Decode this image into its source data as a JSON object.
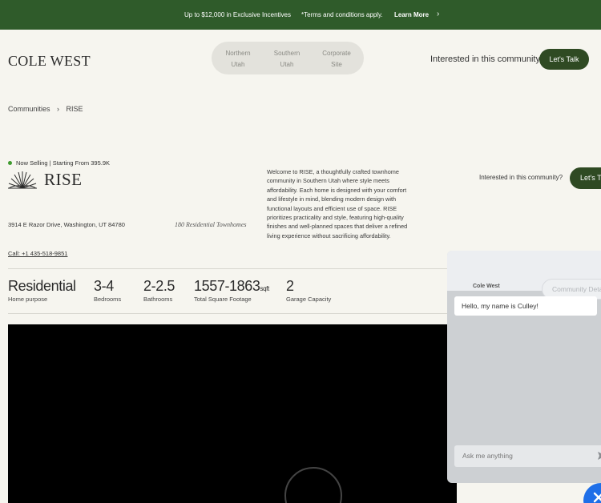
{
  "promo": {
    "incentive": "Up to $12,000 in Exclusive Incentives",
    "terms": "*Terms and conditions apply.",
    "learn_more": "Learn More",
    "chevron": "›"
  },
  "brand": {
    "logo": "COLE WEST"
  },
  "regions": [
    {
      "label1": "Northern",
      "label2": "Utah"
    },
    {
      "label1": "Southern",
      "label2": "Utah"
    },
    {
      "label1": "Corporate",
      "label2": "Site"
    }
  ],
  "header": {
    "interested": "Interested in this community?",
    "lets_talk": "Let's Talk"
  },
  "breadcrumb": {
    "root": "Communities",
    "separator": "›",
    "current": "RISE"
  },
  "community": {
    "status": "Now Selling | Starting From 395.9K",
    "name": "RISE",
    "address": "3914 E Razor Drive, Washington, UT 84780",
    "tagline": "180 Residential Townhomes",
    "call": "Call: +1 435-518-9851",
    "description": "Welcome to RISE, a thoughtfully crafted townhome community in Southern Utah where style meets affordability. Each home is designed with your comfort and lifestyle in mind, blending modern design with functional layouts and efficient use of space. RISE prioritizes practicality and style, featuring high-quality finishes and well-planned spaces that deliver a refined living experience without sacrificing affordability."
  },
  "side_cta": {
    "interested": "Interested in this community?",
    "lets_talk": "Let's Talk"
  },
  "stats": [
    {
      "value": "Residential",
      "unit": "",
      "label": "Home purpose"
    },
    {
      "value": "3-4",
      "unit": "",
      "label": "Bedrooms"
    },
    {
      "value": "2-2.5",
      "unit": "",
      "label": "Bathrooms"
    },
    {
      "value": "1557-1863",
      "unit": "sqft",
      "label": "Total Square Footage"
    },
    {
      "value": "2",
      "unit": "",
      "label": "Garage Capacity"
    }
  ],
  "chat": {
    "brand": "Cole West",
    "tab": "Community Details",
    "greeting": "Hello, my name is Culley!",
    "placeholder": "Ask me anything",
    "send_icon": "send-icon",
    "close_icon": "close-icon"
  },
  "colors": {
    "promo_bg": "#2f5b2a",
    "button_bg": "#2f4a23",
    "status_dot": "#3f9b2f",
    "fab": "#1f6fe8",
    "page_bg": "#f6f5ef"
  }
}
